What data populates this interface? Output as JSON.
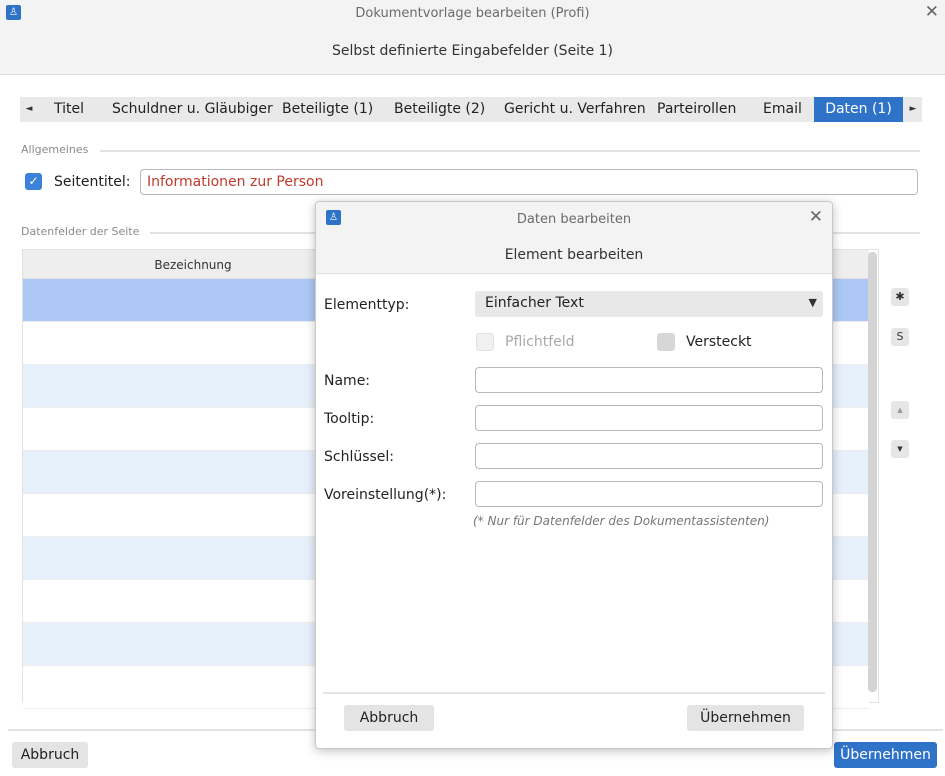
{
  "window": {
    "title": "Dokumentvorlage bearbeiten (Profi)",
    "subtitle": "Selbst definierte Eingabefelder (Seite 1)",
    "close_symbol": "✕"
  },
  "tabs": {
    "prev_symbol": "◄",
    "next_symbol": "►",
    "items": [
      {
        "label": "Titel"
      },
      {
        "label": "Schuldner u. Gläubiger"
      },
      {
        "label": "Beteiligte (1)"
      },
      {
        "label": "Beteiligte (2)"
      },
      {
        "label": "Gericht u. Verfahren"
      },
      {
        "label": "Parteirollen"
      },
      {
        "label": "Email"
      },
      {
        "label": "Daten (1)",
        "active": true
      }
    ]
  },
  "allgemeines": {
    "section_label": "Allgemeines",
    "seitentitel_label": "Seitentitel:",
    "seitentitel_value": "Informationen zur Person",
    "seitentitel_checked": true
  },
  "datenfelder": {
    "section_label": "Datenfelder der Seite",
    "column_bezeichnung": "Bezeichnung"
  },
  "side_buttons": {
    "gear": "✱",
    "s": "S",
    "up": "▲",
    "down": "▼"
  },
  "footer": {
    "cancel_label": "Abbruch",
    "apply_label": "Übernehmen"
  },
  "dialog": {
    "title": "Daten bearbeiten",
    "subtitle": "Element bearbeiten",
    "close_symbol": "✕",
    "elementtyp_label": "Elementtyp:",
    "elementtyp_value": "Einfacher Text",
    "pflichtfeld_label": "Pflichtfeld",
    "versteckt_label": "Versteckt",
    "name_label": "Name:",
    "name_value": "",
    "tooltip_label": "Tooltip:",
    "tooltip_value": "",
    "schluessel_label": "Schlüssel:",
    "schluessel_value": "",
    "voreinstellung_label": "Voreinstellung(*):",
    "voreinstellung_value": "",
    "hint": "(* Nur für Datenfelder des Dokumentassistenten)",
    "cancel_label": "Abbruch",
    "apply_label": "Übernehmen"
  },
  "colors": {
    "accent": "#2f73c9",
    "selected_row": "#adc8f5",
    "alt_row": "#e7f1fb",
    "title_value": "#c0392b"
  }
}
